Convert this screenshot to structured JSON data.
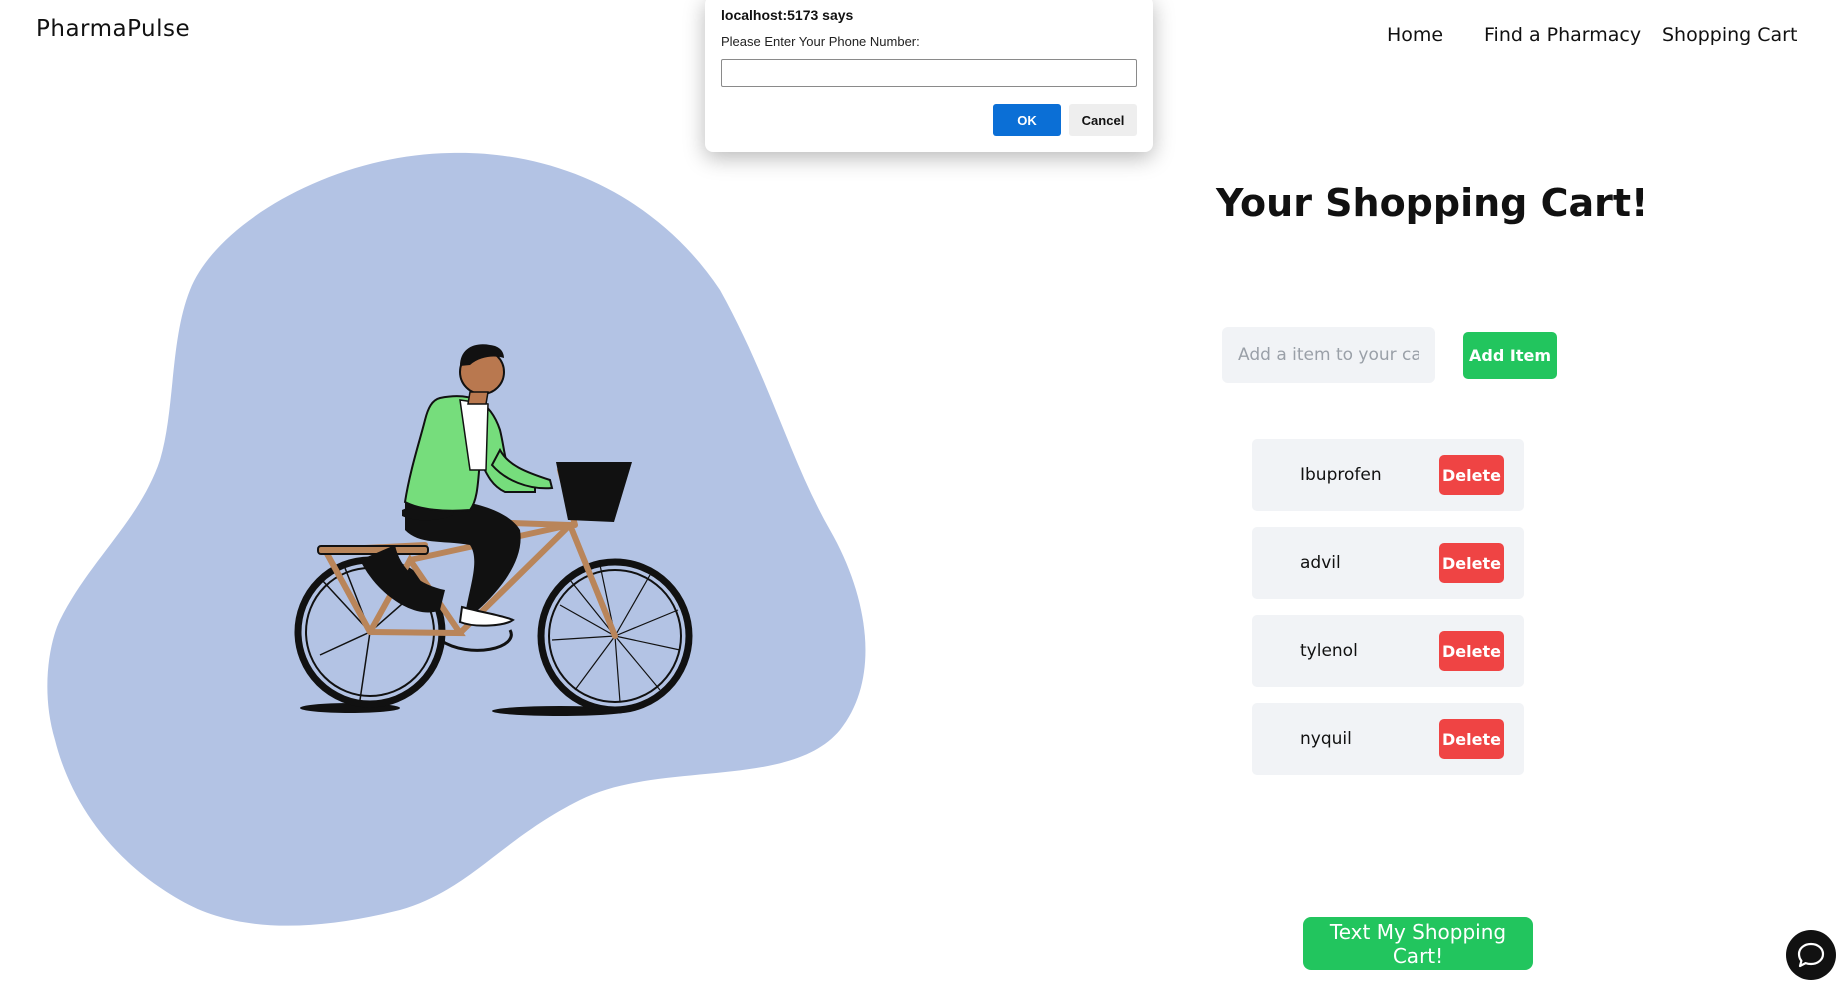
{
  "header": {
    "logo": "PharmaPulse",
    "nav": [
      "Home",
      "Find a Pharmacy",
      "Shopping Cart"
    ]
  },
  "cart": {
    "title": "Your Shopping Cart!",
    "input_placeholder": "Add a item to your cart...",
    "add_label": "Add Item",
    "delete_label": "Delete",
    "items": [
      "Ibuprofen",
      "advil",
      "tylenol",
      "nyquil"
    ],
    "text_button": "Text My Shopping Cart!"
  },
  "dialog": {
    "title": "localhost:5173 says",
    "message": "Please Enter Your Phone Number:",
    "input_value": "",
    "ok_label": "OK",
    "cancel_label": "Cancel"
  },
  "icons": {
    "chat": "chat-bubble-icon",
    "illustration": "person-riding-bicycle-illustration"
  },
  "colors": {
    "blob": "#b3c3e4",
    "accent_green": "#22c55e",
    "delete_red": "#ef4444",
    "dialog_ok_blue": "#0b6fd6",
    "jacket_green": "#76dd7c"
  }
}
